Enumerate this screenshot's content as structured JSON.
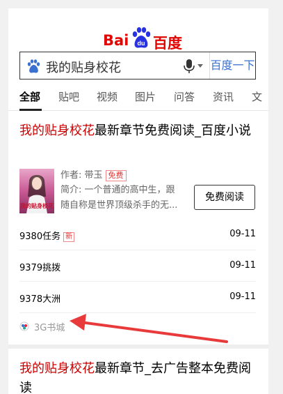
{
  "logo": {
    "text_bai": "Bai",
    "text_du": "du",
    "text_cn": "百度"
  },
  "search": {
    "query": "我的贴身校花",
    "button_label": "百度一下"
  },
  "tabs": [
    {
      "label": "全部",
      "active": true
    },
    {
      "label": "贴吧"
    },
    {
      "label": "视频"
    },
    {
      "label": "图片"
    },
    {
      "label": "问答"
    },
    {
      "label": "资讯"
    },
    {
      "label": "文"
    }
  ],
  "result1": {
    "title_highlight": "我的贴身校花",
    "title_rest": "最新章节免费阅读_百度小说",
    "author_label": "作者:",
    "author": "带玉",
    "free_tag": "免费",
    "desc_line1": "简介: 一个普通的高中生，跟",
    "desc_line2": "随自称是世界顶级杀手的无...",
    "read_button": "免费阅读",
    "cover_text": "我的贴身校花",
    "chapters": [
      {
        "name": "9380任务",
        "tag": "新",
        "date": "09-11"
      },
      {
        "name": "9379挑拨",
        "tag": "",
        "date": "09-11"
      },
      {
        "name": "9378大洲",
        "tag": "",
        "date": "09-11"
      }
    ],
    "source": "3G书城"
  },
  "result2": {
    "title_highlight": "我的贴身校花",
    "title_rest": "最新章节_去广告整本免费阅读"
  },
  "colors": {
    "highlight_red": "#cc0000",
    "baidu_red": "#e10601",
    "baidu_blue": "#2932e1",
    "link_blue": "#3a70cf",
    "annotation_arrow": "#e83a3a"
  }
}
